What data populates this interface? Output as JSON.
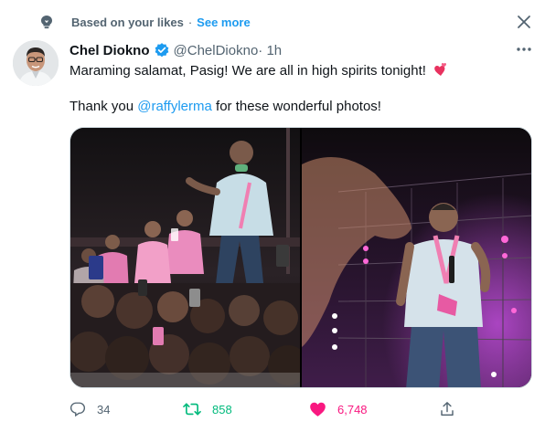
{
  "context": {
    "label": "Based on your likes",
    "separator": "·",
    "see_more": "See more",
    "icon": "lightbulb-icon"
  },
  "author": {
    "display_name": "Chel Diokno",
    "handle": "@ChelDiokno",
    "time": " · 1h",
    "verified": true
  },
  "tweet": {
    "line1": "Maraming salamat, Pasig! We are all in high spirits tonight!",
    "line2_prefix": "Thank you ",
    "mention": "@raffylerma",
    "line2_suffix": " for these wonderful photos!",
    "emoji": "two-hearts"
  },
  "media": {
    "photos": [
      "rally-crowd-photo",
      "speaker-on-stage-photo"
    ]
  },
  "actions": {
    "reply_count": "34",
    "retweet_count": "858",
    "like_count": "6,748",
    "liked": true,
    "retweeted": true
  },
  "colors": {
    "accent": "#1d9bf0",
    "retweet": "#00ba7c",
    "like": "#f91880",
    "secondary_text": "#536471"
  }
}
